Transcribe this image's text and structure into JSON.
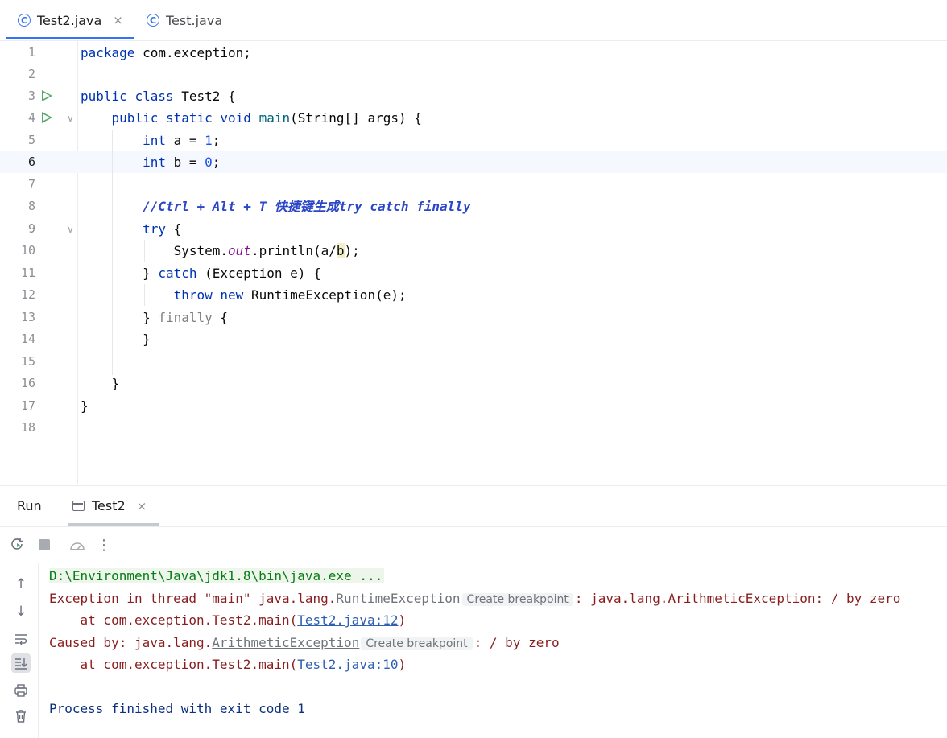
{
  "tabs": [
    {
      "label": "Test2.java",
      "active": true,
      "close": "×"
    },
    {
      "label": "Test.java",
      "active": false
    }
  ],
  "editor": {
    "line_numbers": [
      "1",
      "2",
      "3",
      "4",
      "5",
      "6",
      "7",
      "8",
      "9",
      "10",
      "11",
      "12",
      "13",
      "14",
      "15",
      "16",
      "17",
      "18"
    ],
    "current_line": "6",
    "lines": {
      "l1": {
        "kw": "package",
        "rest": " com.exception;"
      },
      "l3": {
        "kw1": "public",
        "kw2": "class",
        "rest": " Test2 {"
      },
      "l4": {
        "kw1": "public",
        "kw2": "static",
        "kw3": "void",
        "fn": "main",
        "rest": "(String[] args) {"
      },
      "l5": {
        "kw": "int",
        "mid": " a = ",
        "num": "1",
        "end": ";"
      },
      "l6": {
        "kw": "int",
        "mid": " b = ",
        "num": "0",
        "end": ";"
      },
      "l8": {
        "comment": "//Ctrl + Alt + T 快捷键生成try catch finally"
      },
      "l9": {
        "kw": "try",
        "rest": " {"
      },
      "l10": {
        "pre": "System.",
        "static": "out",
        "mid": ".println(a/",
        "hl": "b",
        "end": ");"
      },
      "l11": {
        "pre": "} ",
        "kw": "catch",
        "rest": " (Exception e) {"
      },
      "l12": {
        "kw1": "throw",
        "kw2": "new",
        "rest": " RuntimeException(e);"
      },
      "l13": {
        "pre": "} ",
        "kw": "finally",
        "rest": " {"
      },
      "l14": {
        "text": "}"
      },
      "l16": {
        "text": "}"
      },
      "l17": {
        "text": "}"
      }
    }
  },
  "run_panel": {
    "title": "Run",
    "tab_label": "Test2",
    "tab_close": "×",
    "console": {
      "cmd": "D:\\Environment\\Java\\jdk1.8\\bin\\java.exe ...",
      "ex1_pre": "Exception in thread \"main\" java.lang.",
      "ex1_link": "RuntimeException",
      "breakpoint_label": "Create breakpoint",
      "ex1_post": ": java.lang.ArithmeticException: / by zero",
      "at1_pre": "    at com.exception.Test2.main(",
      "at1_link": "Test2.java:12",
      "at_post": ")",
      "cause_pre": "Caused by: java.lang.",
      "cause_link": "ArithmeticException",
      "cause_post": ": / by zero",
      "at2_pre": "    at com.exception.Test2.main(",
      "at2_link": "Test2.java:10",
      "finish": "Process finished with exit code 1"
    },
    "icons": {
      "rerun": "rerun-icon",
      "stop": "stop-icon",
      "profiler": "profiler-icon",
      "more": "more-icon",
      "up": "arrow-up-icon",
      "down": "arrow-down-icon",
      "softwrap": "soft-wrap-icon",
      "scrollend": "scroll-to-end-icon",
      "print": "print-icon",
      "trash": "trash-icon"
    }
  }
}
